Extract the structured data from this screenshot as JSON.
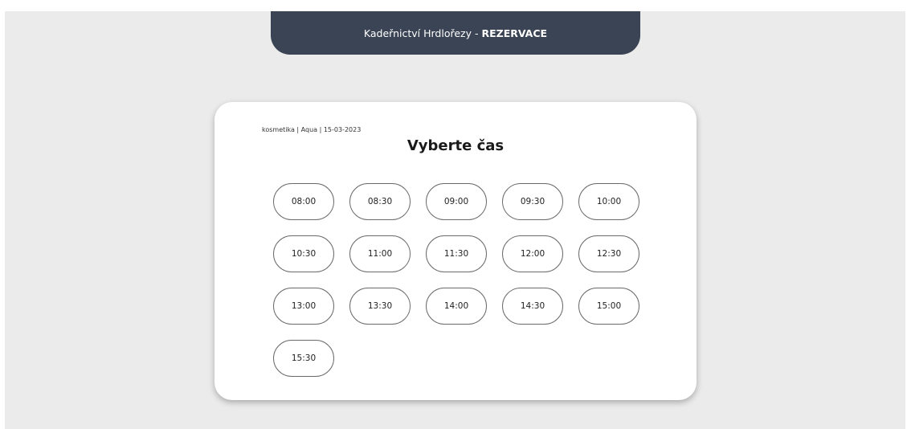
{
  "header": {
    "brand": "Kadeřnictví Hrdlořezy",
    "separator": " - ",
    "section": "REZERVACE"
  },
  "card": {
    "breadcrumb": "kosmetika | Aqua | 15-03-2023",
    "title": "Vyberte čas",
    "slots": [
      "08:00",
      "08:30",
      "09:00",
      "09:30",
      "10:00",
      "10:30",
      "11:00",
      "11:30",
      "12:00",
      "12:30",
      "13:00",
      "13:30",
      "14:00",
      "14:30",
      "15:00",
      "15:30"
    ]
  },
  "colors": {
    "header_bg": "#3a4454",
    "page_bg": "#ebebeb",
    "card_bg": "#ffffff",
    "slot_border": "#6b6b6b"
  }
}
